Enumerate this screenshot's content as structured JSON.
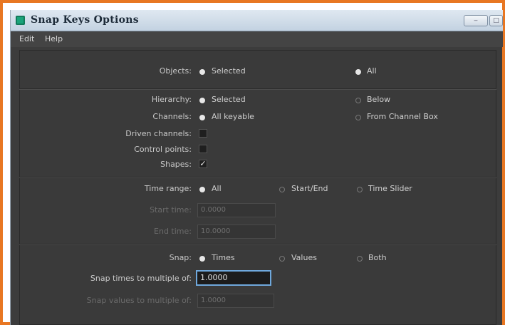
{
  "window": {
    "title": "Snap Keys Options"
  },
  "menu": [
    "Edit",
    "Help"
  ],
  "objects": {
    "label": "Objects:",
    "options": [
      "Selected",
      "All"
    ],
    "selected": "Selected"
  },
  "hierarchy": {
    "label": "Hierarchy:",
    "options": [
      "Selected",
      "Below"
    ],
    "selected": "Selected"
  },
  "channels": {
    "label": "Channels:",
    "options": [
      "All keyable",
      "From Channel Box"
    ],
    "selected": "All keyable"
  },
  "driven_channels": {
    "label": "Driven channels:",
    "checked": false
  },
  "control_points": {
    "label": "Control points:",
    "checked": false
  },
  "shapes": {
    "label": "Shapes:",
    "checked": true,
    "mark": "✓"
  },
  "time_range": {
    "label": "Time range:",
    "options": [
      "All",
      "Start/End",
      "Time Slider"
    ],
    "selected": "All"
  },
  "start_time": {
    "label": "Start time:",
    "value": "0.0000"
  },
  "end_time": {
    "label": "End time:",
    "value": "10.0000"
  },
  "snap": {
    "label": "Snap:",
    "options": [
      "Times",
      "Values",
      "Both"
    ],
    "selected": "Times"
  },
  "snap_times_multiple": {
    "label": "Snap times to multiple of:",
    "value": "1.0000"
  },
  "snap_values_multiple": {
    "label": "Snap values to multiple of:",
    "value": "1.0000"
  }
}
